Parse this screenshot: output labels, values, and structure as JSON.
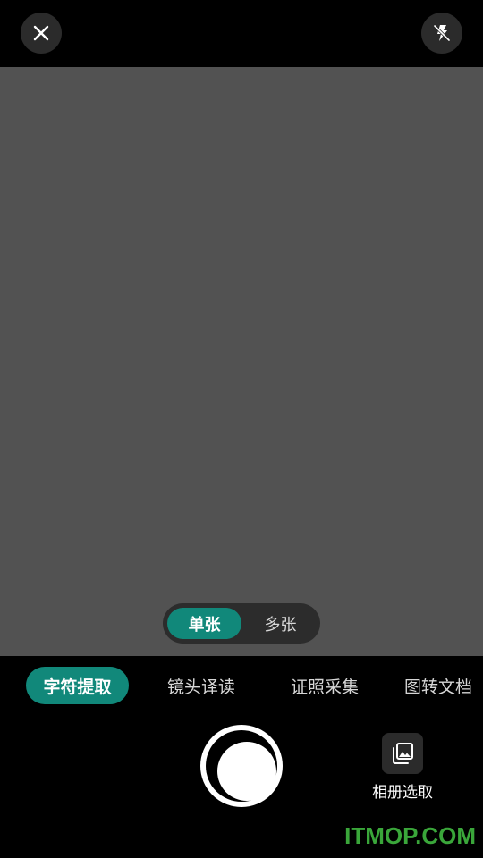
{
  "top_bar": {
    "close_icon": "close-icon",
    "flash_icon": "flash-off-icon"
  },
  "mode_toggle": {
    "single_label": "单张",
    "multi_label": "多张",
    "selected": "单张"
  },
  "tabs": [
    {
      "label": "字符提取",
      "active": true
    },
    {
      "label": "镜头译读",
      "active": false
    },
    {
      "label": "证照采集",
      "active": false
    },
    {
      "label": "图转文档",
      "active": false
    }
  ],
  "album": {
    "label": "相册选取",
    "icon": "gallery-icon"
  },
  "watermark": "ITMOP.COM",
  "colors": {
    "accent": "#11887a",
    "viewfinder": "#525252",
    "background": "#000000",
    "watermark": "#3aa63a"
  }
}
